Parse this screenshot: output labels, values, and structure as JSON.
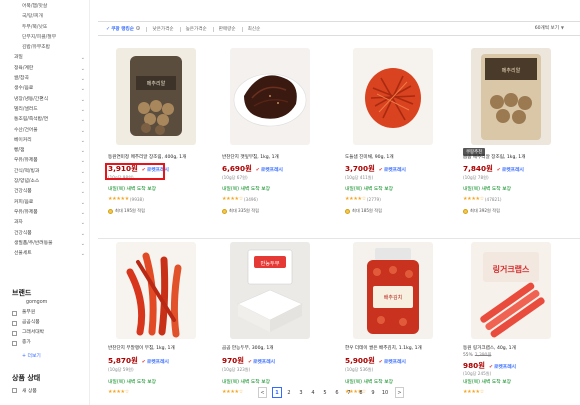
{
  "sidebar": {
    "categories": [
      {
        "label": "어묵/햄/맛살",
        "sub": true,
        "chevron": false
      },
      {
        "label": "국/탕/찌개",
        "sub": true,
        "chevron": false
      },
      {
        "label": "두부/묵/낫또",
        "sub": true,
        "chevron": false
      },
      {
        "label": "단무지/피클/절무",
        "sub": true,
        "chevron": false
      },
      {
        "label": "김밥/유부초밥",
        "sub": true,
        "chevron": false
      },
      {
        "label": "과일",
        "sub": false,
        "chevron": true
      },
      {
        "label": "정육/계란",
        "sub": false,
        "chevron": true
      },
      {
        "label": "쌀/잡곡",
        "sub": false,
        "chevron": true
      },
      {
        "label": "생수/음료",
        "sub": false,
        "chevron": true
      },
      {
        "label": "냉장/냉동/간편식",
        "sub": false,
        "chevron": true
      },
      {
        "label": "델리/샐러드",
        "sub": false,
        "chevron": true
      },
      {
        "label": "통조림/즉석밥/면",
        "sub": false,
        "chevron": true
      },
      {
        "label": "수산/건어물",
        "sub": false,
        "chevron": true
      },
      {
        "label": "베이커리",
        "sub": false,
        "chevron": true
      },
      {
        "label": "빵/잼",
        "sub": false,
        "chevron": true
      },
      {
        "label": "우유/유제품",
        "sub": false,
        "chevron": true
      },
      {
        "label": "간식/떡/빙과",
        "sub": false,
        "chevron": true
      },
      {
        "label": "장/양념/소스",
        "sub": false,
        "chevron": true
      },
      {
        "label": "건강식품",
        "sub": false,
        "chevron": true
      },
      {
        "label": "커피/음료",
        "sub": false,
        "chevron": true
      },
      {
        "label": "우유/유제품",
        "sub": false,
        "chevron": true
      },
      {
        "label": "과자",
        "sub": false,
        "chevron": true
      },
      {
        "label": "건강식품",
        "sub": false,
        "chevron": true
      },
      {
        "label": "생필품/주/반려동물",
        "sub": false,
        "chevron": true
      },
      {
        "label": "선물세트",
        "sub": false,
        "chevron": true
      }
    ],
    "brand_title": "브랜드",
    "brands": [
      {
        "label": "gomgom",
        "checkbox": false
      },
      {
        "label": "풀무원",
        "checkbox": true
      },
      {
        "label": "곰곰식품",
        "checkbox": true
      },
      {
        "label": "그래서대박",
        "checkbox": true
      },
      {
        "label": "종가",
        "checkbox": true
      }
    ],
    "more_label": "+ 더보기",
    "status_title": "상품 상태",
    "status_item": "새 상품"
  },
  "sortbar": {
    "options": [
      {
        "label": "쿠팡 랭킹순",
        "active": true
      },
      {
        "label": "낮은가격순",
        "active": false
      },
      {
        "label": "높은가격순",
        "active": false
      },
      {
        "label": "판매량순",
        "active": false
      },
      {
        "label": "최신순",
        "active": false
      }
    ],
    "view_label": "60개씩 보기"
  },
  "products": [
    {
      "badge": "",
      "name": "동원연미정 메추리알 장조림, 400g, 1개",
      "price": "3,910원",
      "discount": "",
      "original": "",
      "unit": "(10g당 98원)",
      "rocket": "로켓프레시",
      "delivery": "내일(목) 새벽 도착 보장",
      "rating": 5,
      "reviews": "(9938)",
      "reward": "최대 195원 적립",
      "image": "egg-jar"
    },
    {
      "badge": "",
      "name": "반찬단지 깻잎무침, 1kg, 1개",
      "price": "6,690원",
      "discount": "",
      "original": "",
      "unit": "(10g당 67원)",
      "rocket": "로켓프레시",
      "delivery": "내일(목) 새벽 도착 보장",
      "rating": 4.5,
      "reviews": "(3496)",
      "reward": "최대 335원 적립",
      "image": "sesame-leaves"
    },
    {
      "badge": "",
      "name": "도들샘 진미채, 90g, 1개",
      "price": "3,700원",
      "discount": "",
      "original": "",
      "unit": "(10g당 411원)",
      "rocket": "로켓프레시",
      "delivery": "내일(목) 새벽 도착 보장",
      "rating": 4.5,
      "reviews": "(2779)",
      "reward": "최대 185원 적립",
      "image": "squid"
    },
    {
      "badge": "쿠팡추천",
      "name": "곰곰 메추리알 장조림, 1kg, 1개",
      "price": "7,840원",
      "discount": "",
      "original": "",
      "unit": "(10g당 78원)",
      "rocket": "로켓프레시",
      "delivery": "내일(목) 새벽 도착 보장",
      "rating": 4.5,
      "reviews": "(47821)",
      "reward": "최대 392원 적립",
      "image": "egg-pouch"
    },
    {
      "badge": "",
      "name": "반찬단지 무말랭이 무침, 1kg, 1개",
      "price": "5,870원",
      "discount": "",
      "original": "",
      "unit": "(10g당 59원)",
      "rocket": "로켓프레시",
      "delivery": "내일(목) 새벽 도착 보장",
      "rating": 4.5,
      "reviews": "",
      "reward": "",
      "image": "radish"
    },
    {
      "badge": "",
      "name": "곰곰 만능두부, 300g, 1개",
      "price": "970원",
      "discount": "",
      "original": "",
      "unit": "(10g당 323원)",
      "rocket": "로켓프레시",
      "delivery": "내일(목) 새벽 도착 보장",
      "rating": 4.5,
      "reviews": "",
      "reward": "",
      "image": "tofu"
    },
    {
      "badge": "",
      "name": "한우 더테이 썰은 배추김치, 1.1kg, 1개",
      "price": "5,900원",
      "discount": "",
      "original": "",
      "unit": "(10g당 536원)",
      "rocket": "로켓프레시",
      "delivery": "내일(목) 새벽 도착 보장",
      "rating": 4.5,
      "reviews": "",
      "reward": "",
      "image": "kimchi"
    },
    {
      "badge": "",
      "name": "동원 링거크랩스, 40g, 1개",
      "price": "980원",
      "discount": "55%",
      "original": "2,390원",
      "unit": "(10g당 245원)",
      "rocket": "로켓프레시",
      "delivery": "내일(목) 새벽 도착 보장",
      "rating": 4.5,
      "reviews": "",
      "reward": "",
      "image": "crab"
    }
  ],
  "pagination": {
    "prev": "<",
    "next": ">",
    "pages": [
      "1",
      "2",
      "3",
      "4",
      "5",
      "6",
      "7",
      "8",
      "9",
      "10"
    ],
    "current": "1"
  },
  "colors": {
    "price": "#ae0000",
    "rocket": "#346aff",
    "delivery": "#00891a",
    "highlight": "#e5151b",
    "star": "#f5a623"
  }
}
